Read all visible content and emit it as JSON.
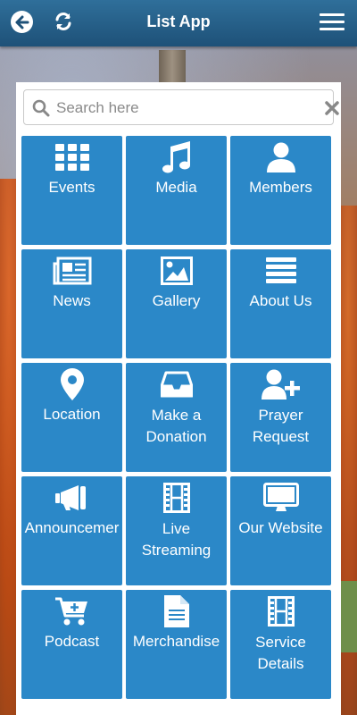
{
  "header": {
    "title": "List App"
  },
  "search": {
    "placeholder": "Search here"
  },
  "tiles": [
    {
      "label": "Events",
      "icon": "grid-icon"
    },
    {
      "label": "Media",
      "icon": "music-icon"
    },
    {
      "label": "Members",
      "icon": "user-icon"
    },
    {
      "label": "News",
      "icon": "newspaper-icon"
    },
    {
      "label": "Gallery",
      "icon": "picture-icon"
    },
    {
      "label": "About Us",
      "icon": "list-icon"
    },
    {
      "label": "Location",
      "icon": "map-pin-icon"
    },
    {
      "label": "Make a\nDonation",
      "icon": "inbox-icon"
    },
    {
      "label": "Prayer\nRequest",
      "icon": "add-user-icon"
    },
    {
      "label": "Announcemer",
      "icon": "megaphone-icon"
    },
    {
      "label": "Live\nStreaming",
      "icon": "film-icon"
    },
    {
      "label": "Our Website",
      "icon": "monitor-icon"
    },
    {
      "label": "Podcast",
      "icon": "cart-plus-icon"
    },
    {
      "label": "Merchandise",
      "icon": "document-icon"
    },
    {
      "label": "Service\nDetails",
      "icon": "film-icon"
    }
  ],
  "colors": {
    "header": "#1e5178",
    "tile": "#2b88c8",
    "panel": "#ffffff"
  }
}
